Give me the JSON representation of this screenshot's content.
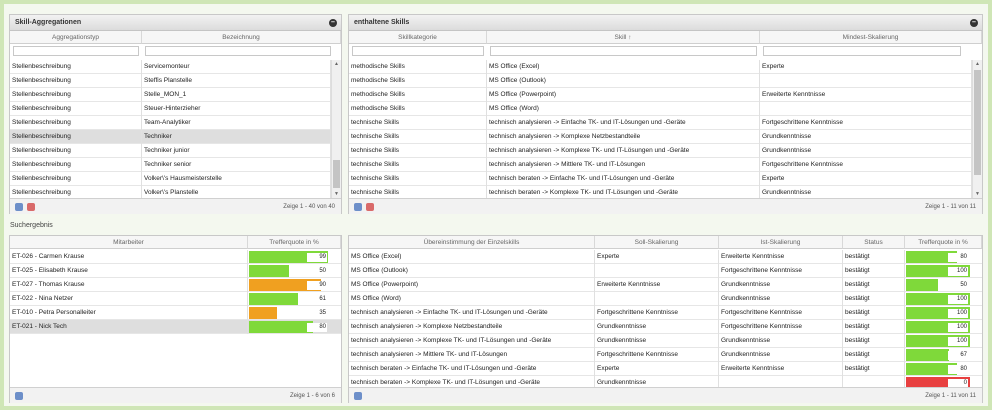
{
  "colors": {
    "green": "#7fd93a",
    "orange": "#f0a020",
    "red": "#e84040"
  },
  "p1": {
    "title": "Skill-Aggregationen",
    "cols": [
      "Aggregationstyp",
      "Bezeichnung"
    ],
    "rows": [
      [
        "Stellenbeschreibung",
        "Servicemonteur"
      ],
      [
        "Stellenbeschreibung",
        "Steffis Planstelle"
      ],
      [
        "Stellenbeschreibung",
        "Stelle_MON_1"
      ],
      [
        "Stellenbeschreibung",
        "Steuer-Hinterzieher"
      ],
      [
        "Stellenbeschreibung",
        "Team-Analytiker"
      ],
      [
        "Stellenbeschreibung",
        "Techniker"
      ],
      [
        "Stellenbeschreibung",
        "Techniker junior"
      ],
      [
        "Stellenbeschreibung",
        "Techniker senior"
      ],
      [
        "Stellenbeschreibung",
        "Volker\\'s Hausmeisterstelle"
      ],
      [
        "Stellenbeschreibung",
        "Volker\\'s Planstelle"
      ]
    ],
    "selected_index": 5,
    "footer": "Zeige 1 - 40 von 40"
  },
  "p2": {
    "title": "enthaltene Skills",
    "cols": [
      "Skillkategorie",
      "Skill ↑",
      "Mindest-Skalierung"
    ],
    "rows": [
      [
        "methodische Skills",
        "MS Office (Excel)",
        "Experte"
      ],
      [
        "methodische Skills",
        "MS Office (Outlook)",
        ""
      ],
      [
        "methodische Skills",
        "MS Office (Powerpoint)",
        "Erweiterte Kenntnisse"
      ],
      [
        "methodische Skills",
        "MS Office (Word)",
        ""
      ],
      [
        "technische Skills",
        "technisch analysieren -> Einfache TK- und IT-Lösungen und -Geräte",
        "Fortgeschrittene Kenntnisse"
      ],
      [
        "technische Skills",
        "technisch analysieren -> Komplexe Netzbestandteile",
        "Grundkenntnisse"
      ],
      [
        "technische Skills",
        "technisch analysieren -> Komplexe TK- und IT-Lösungen und -Geräte",
        "Grundkenntnisse"
      ],
      [
        "technische Skills",
        "technisch analysieren -> Mittlere TK- und IT-Lösungen",
        "Fortgeschrittene Kenntnisse"
      ],
      [
        "technische Skills",
        "technisch beraten -> Einfache TK- und IT-Lösungen und -Geräte",
        "Experte"
      ],
      [
        "technische Skills",
        "technisch beraten -> Komplexe TK- und IT-Lösungen und -Geräte",
        "Grundkenntnisse"
      ]
    ],
    "footer": "Zeige 1 - 11 von 11"
  },
  "search_label": "Suchergebnis",
  "p3": {
    "cols": [
      "Mitarbeiter",
      "Trefferquote in %"
    ],
    "rows": [
      {
        "name": "ET-026 - Carmen Krause",
        "pct": 99,
        "label": "99",
        "color": "green"
      },
      {
        "name": "ET-025 - Elisabeth Krause",
        "pct": 50,
        "label": "50",
        "color": "green"
      },
      {
        "name": "ET-027 - Thomas Krause",
        "pct": 90,
        "label": "90",
        "color": "orange"
      },
      {
        "name": "ET-022 - Nina Netzer",
        "pct": 61,
        "label": "61",
        "color": "green"
      },
      {
        "name": "ET-010 - Petra Personalleiter",
        "pct": 35,
        "label": "35",
        "color": "orange"
      },
      {
        "name": "ET-021 - Nick Tech",
        "pct": 80,
        "label": "80",
        "color": "green"
      }
    ],
    "selected_index": 5,
    "footer": "Zeige 1 - 6 von 6"
  },
  "p4": {
    "cols": [
      "Übereinstimmung der Einzelskills",
      "Soll-Skalierung",
      "Ist-Skalierung",
      "Status",
      "Trefferquote in %"
    ],
    "rows": [
      {
        "skill": "MS Office (Excel)",
        "soll": "Experte",
        "ist": "Erweiterte Kenntnisse",
        "status": "bestätigt",
        "pct": 80,
        "label": "80",
        "color": "green"
      },
      {
        "skill": "MS Office (Outlook)",
        "soll": "",
        "ist": "Fortgeschrittene Kenntnisse",
        "status": "bestätigt",
        "pct": 100,
        "label": "100",
        "color": "green"
      },
      {
        "skill": "MS Office (Powerpoint)",
        "soll": "Erweiterte Kenntnisse",
        "ist": "Grundkenntnisse",
        "status": "bestätigt",
        "pct": 50,
        "label": "50",
        "color": "green"
      },
      {
        "skill": "MS Office (Word)",
        "soll": "",
        "ist": "Grundkenntnisse",
        "status": "bestätigt",
        "pct": 100,
        "label": "100",
        "color": "green"
      },
      {
        "skill": "technisch analysieren -> Einfache TK- und IT-Lösungen und -Geräte",
        "soll": "Fortgeschrittene Kenntnisse",
        "ist": "Fortgeschrittene Kenntnisse",
        "status": "bestätigt",
        "pct": 100,
        "label": "100",
        "color": "green"
      },
      {
        "skill": "technisch analysieren -> Komplexe Netzbestandteile",
        "soll": "Grundkenntnisse",
        "ist": "Fortgeschrittene Kenntnisse",
        "status": "bestätigt",
        "pct": 100,
        "label": "100",
        "color": "green"
      },
      {
        "skill": "technisch analysieren -> Komplexe TK- und IT-Lösungen und -Geräte",
        "soll": "Grundkenntnisse",
        "ist": "Grundkenntnisse",
        "status": "bestätigt",
        "pct": 100,
        "label": "100",
        "color": "green"
      },
      {
        "skill": "technisch analysieren -> Mittlere TK- und IT-Lösungen",
        "soll": "Fortgeschrittene Kenntnisse",
        "ist": "Grundkenntnisse",
        "status": "bestätigt",
        "pct": 67,
        "label": "67",
        "color": "green"
      },
      {
        "skill": "technisch beraten -> Einfache TK- und IT-Lösungen und -Geräte",
        "soll": "Experte",
        "ist": "Erweiterte Kenntnisse",
        "status": "bestätigt",
        "pct": 80,
        "label": "80",
        "color": "green"
      },
      {
        "skill": "technisch beraten -> Komplexe TK- und IT-Lösungen und -Geräte",
        "soll": "Grundkenntnisse",
        "ist": "",
        "status": "",
        "pct": 100,
        "label": "0",
        "color": "red"
      }
    ],
    "footer": "Zeige 1 - 11 von 11"
  }
}
